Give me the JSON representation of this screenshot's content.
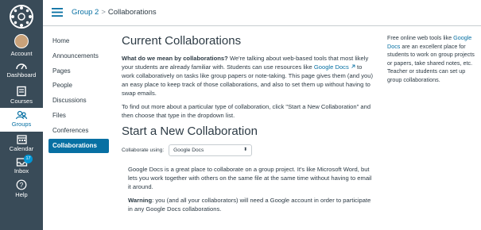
{
  "global_nav": {
    "items": [
      {
        "label": "Account"
      },
      {
        "label": "Dashboard"
      },
      {
        "label": "Courses"
      },
      {
        "label": "Groups"
      },
      {
        "label": "Calendar"
      },
      {
        "label": "Inbox",
        "badge": "17"
      },
      {
        "label": "Help"
      }
    ]
  },
  "header": {
    "group_link": "Group 2",
    "separator": ">",
    "current": "Collaborations"
  },
  "course_nav": {
    "items": [
      {
        "label": "Home"
      },
      {
        "label": "Announcements"
      },
      {
        "label": "Pages"
      },
      {
        "label": "People"
      },
      {
        "label": "Discussions"
      },
      {
        "label": "Files"
      },
      {
        "label": "Conferences"
      },
      {
        "label": "Collaborations"
      }
    ]
  },
  "main": {
    "title": "Current Collaborations",
    "intro_bold": "What do we mean by collaborations?",
    "intro_pre": " We're talking about web-based tools that most likely your students are already familiar with. Students can use resources like ",
    "intro_link": "Google Docs",
    "intro_post": " to work collaboratively on tasks like group papers or note-taking. This page gives them (and you) an easy place to keep track of those collaborations, and also to set them up without having to swap emails.",
    "find_out": "To find out more about a particular type of collaboration, click \"Start a New Collaboration\" and then choose that type in the dropdown list.",
    "start_title": "Start a New Collaboration",
    "collaborate_label": "Collaborate using:",
    "collaborate_value": "Google Docs",
    "desc": "Google Docs is a great place to collaborate on a group project. It's like Microsoft Word, but lets you work together with others on the same file at the same time without having to email it around.",
    "warning_bold": "Warning",
    "warning_text": ": you (and all your collaborators) will need a Google account in order to participate in any Google Docs collaborations."
  },
  "aside": {
    "pre": "Free online web tools like ",
    "link": "Google Docs",
    "post": " are an excellent place for students to work on group projects or papers, take shared notes, etc. Teacher or students can set up group collaborations."
  },
  "colors": {
    "nav_bg": "#394b58",
    "accent": "#0770a3",
    "badge": "#0096d5"
  }
}
